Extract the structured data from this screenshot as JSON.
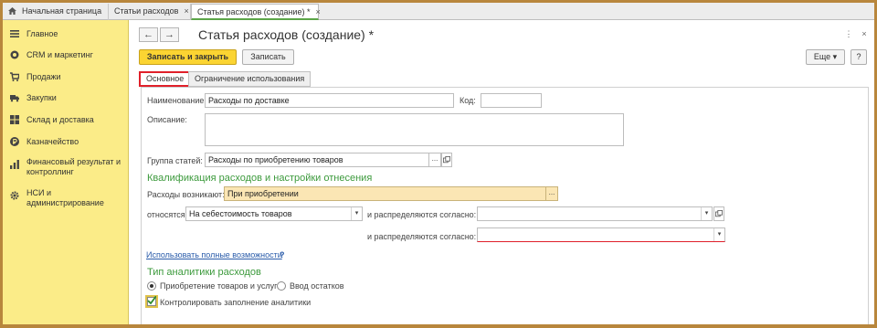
{
  "top_tabs": [
    {
      "label": "Начальная страница"
    },
    {
      "label": "Статьи расходов",
      "close": "×"
    },
    {
      "label": "Статья расходов (создание) *",
      "close": "×"
    }
  ],
  "sidebar": {
    "items": [
      {
        "label": "Главное",
        "icon": "menu-icon"
      },
      {
        "label": "CRM и маркетинг",
        "icon": "crm-icon"
      },
      {
        "label": "Продажи",
        "icon": "cart-icon"
      },
      {
        "label": "Закупки",
        "icon": "truck-icon"
      },
      {
        "label": "Склад и доставка",
        "icon": "warehouse-icon"
      },
      {
        "label": "Казначейство",
        "icon": "ruble-icon"
      },
      {
        "label": "Финансовый результат и контроллинг",
        "icon": "chart-icon"
      },
      {
        "label": "НСИ и администрирование",
        "icon": "gear-icon"
      }
    ]
  },
  "header": {
    "back": "←",
    "forward": "→",
    "title": "Статья расходов (создание) *",
    "more_icon": "⋮",
    "close_icon": "×"
  },
  "toolbar": {
    "save_close": "Записать и закрыть",
    "save": "Записать",
    "more": "Еще",
    "more_arrow": "▾",
    "help": "?"
  },
  "form_tabs": [
    "Основное",
    "Ограничение использования"
  ],
  "form": {
    "name_label": "Наименование:",
    "name_value": "Расходы по доставке",
    "code_label": "Код:",
    "code_value": "",
    "desc_label": "Описание:",
    "desc_value": "",
    "group_label": "Группа статей:",
    "group_value": "Расходы по приобретению товаров",
    "section1": "Квалификация расходов и настройки отнесения",
    "arise_label": "Расходы возникают:",
    "arise_value": "При приобретении",
    "relate_label": "относятся:",
    "relate_value": "На себестоимость товаров",
    "distrib_label1": "и распределяются согласно:",
    "distrib_value1": "",
    "distrib_label2": "и распределяются согласно:",
    "distrib_value2": "",
    "full_link": "Использовать полные возможности",
    "full_q": "?",
    "section2": "Тип аналитики расходов",
    "radio1": "Приобретение товаров и услуг",
    "radio2": "Ввод остатков",
    "checkbox_label": "Контролировать заполнение аналитики",
    "checkbox_checked": true
  },
  "colors": {
    "sidebar_bg": "#fbec88",
    "primary_button": "#fbd432",
    "section_green": "#3c9a3c",
    "active_tab_outline": "#e0202a",
    "link_blue": "#2a5caa",
    "highlight_field": "#fbe6b4"
  }
}
